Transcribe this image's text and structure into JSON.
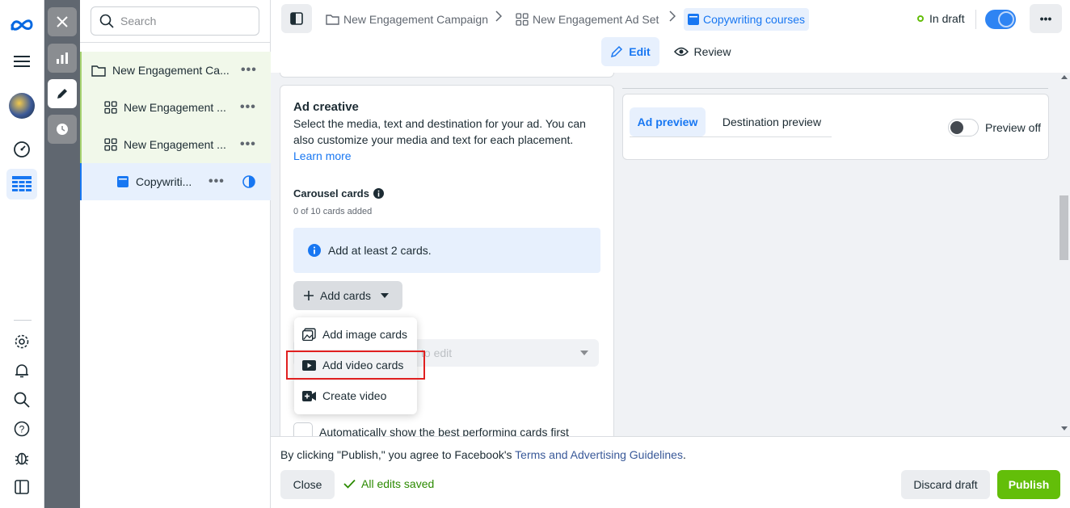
{
  "search": {
    "placeholder": "Search"
  },
  "tree": {
    "items": [
      {
        "label": "New Engagement Ca..."
      },
      {
        "label": "New Engagement ..."
      },
      {
        "label": "New Engagement ..."
      },
      {
        "label": "Copywriti..."
      }
    ],
    "more": "•••"
  },
  "breadcrumb": {
    "campaign": "New Engagement Campaign",
    "adset": "New Engagement Ad Set",
    "ad": "Copywriting courses"
  },
  "status": {
    "label": "In draft"
  },
  "modes": {
    "edit": "Edit",
    "review": "Review"
  },
  "ad_creative": {
    "title": "Ad creative",
    "description": "Select the media, text and destination for your ad. You can also customize your media and text for each placement.",
    "learn_more": "Learn more",
    "carousel_title": "Carousel cards",
    "cards_count": "0 of 10 cards added",
    "notice": "Add at least 2 cards.",
    "add_cards": "Add cards",
    "select_hint": "to edit",
    "auto_show": "Automatically show the best performing cards first"
  },
  "dropdown": {
    "items": [
      {
        "label": "Add image cards"
      },
      {
        "label": "Add video cards"
      },
      {
        "label": "Create video"
      }
    ]
  },
  "preview": {
    "tab_ad": "Ad preview",
    "tab_destination": "Destination preview",
    "toggle_label": "Preview off"
  },
  "footer": {
    "notice_prefix": "By clicking \"Publish,\" you agree to Facebook's ",
    "notice_link": "Terms and Advertising Guidelines",
    "notice_suffix": ".",
    "close": "Close",
    "saved": "All edits saved",
    "discard": "Discard draft",
    "publish": "Publish"
  },
  "colors": {
    "accent": "#1877f2",
    "publish": "#63be09",
    "highlight": "#e02020"
  }
}
